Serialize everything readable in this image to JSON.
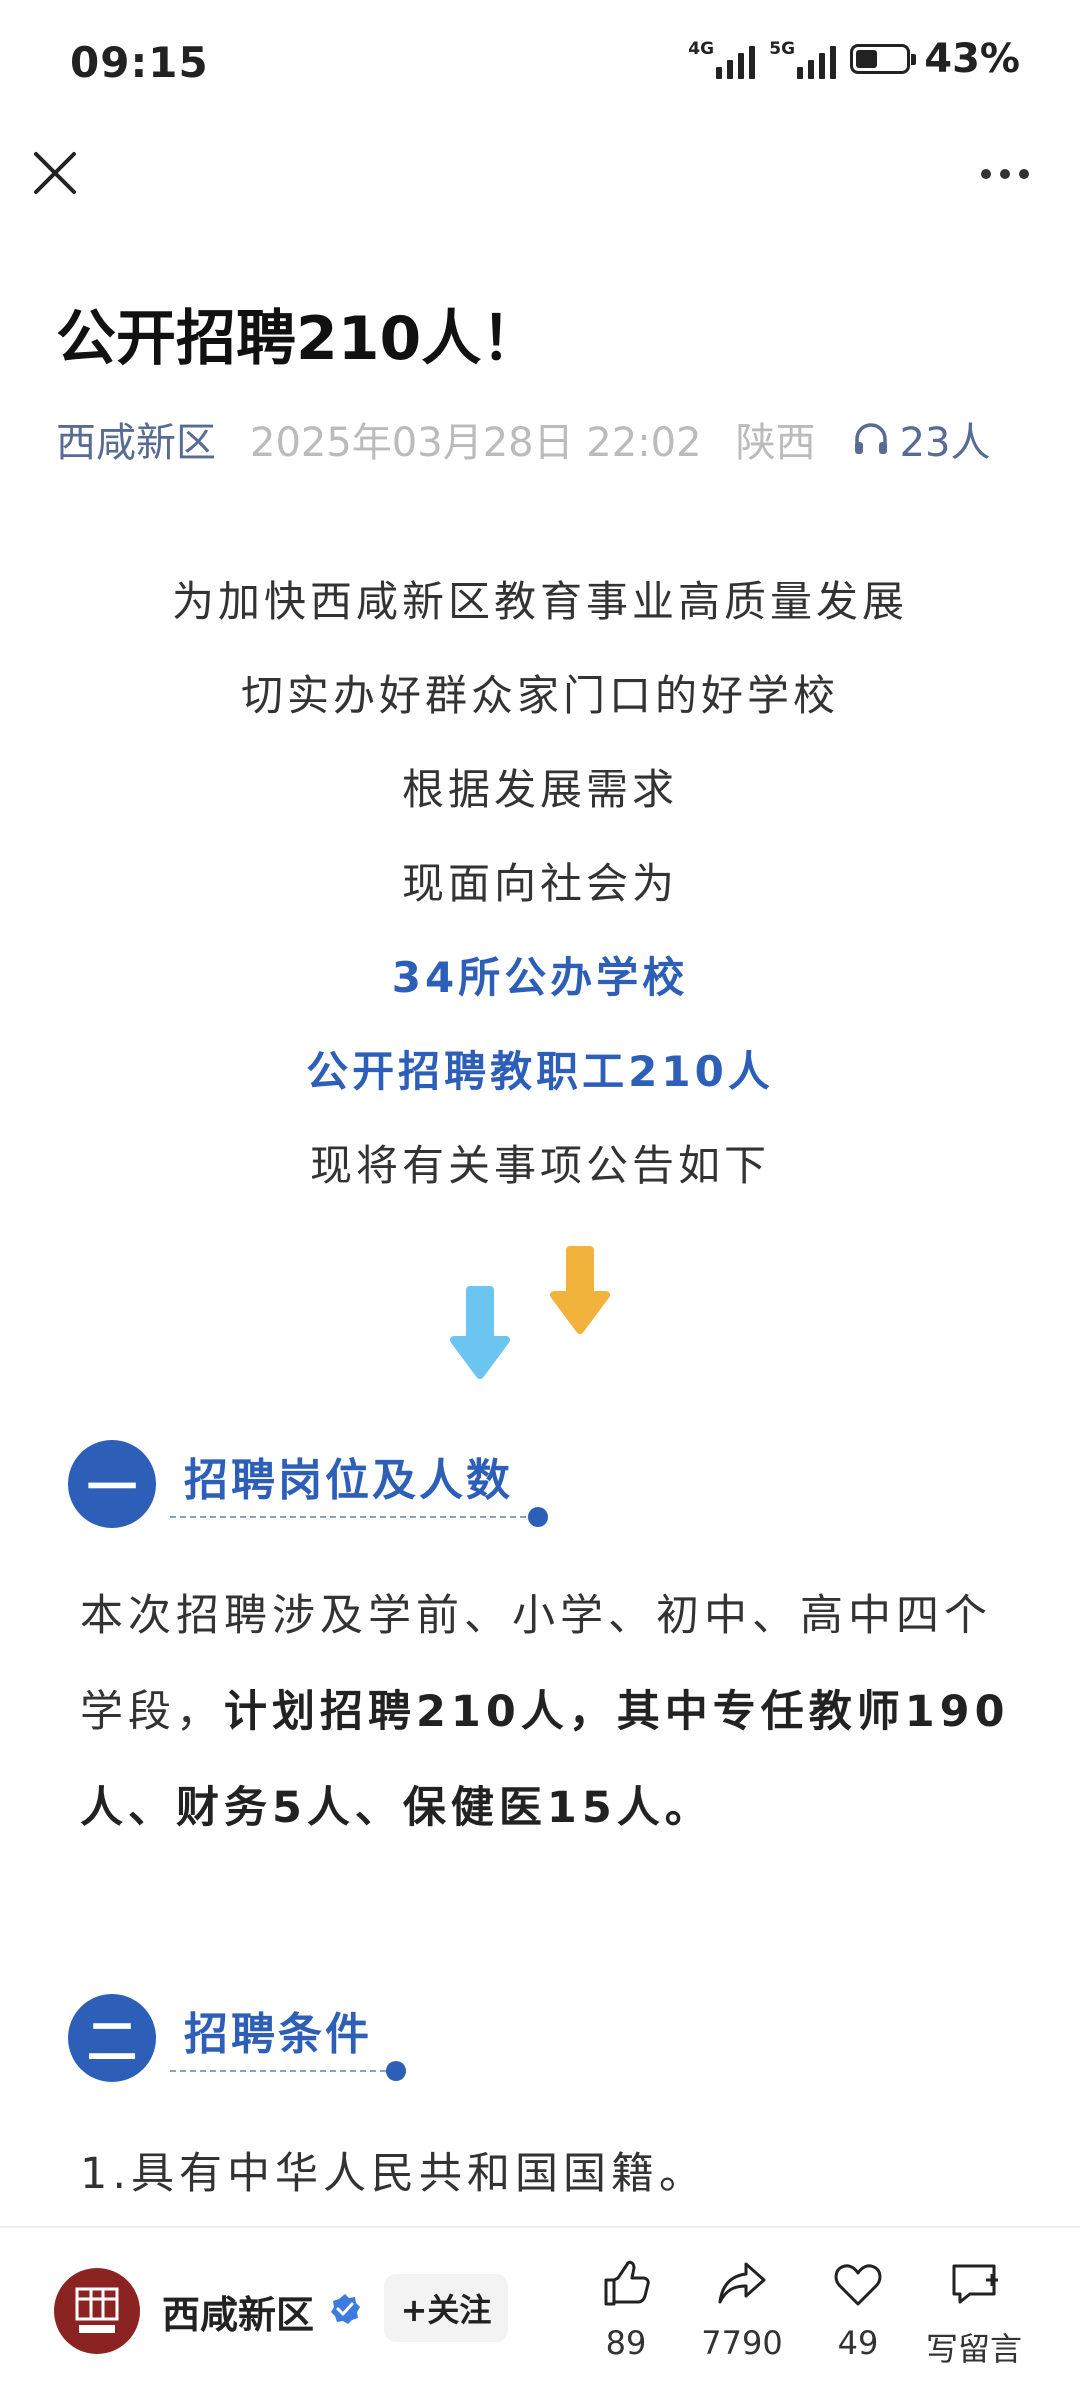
{
  "status_bar": {
    "time": "09:15",
    "signal1_label": "4G",
    "signal2_label": "5G",
    "battery_percent": "43%",
    "battery_level": 0.43
  },
  "article": {
    "title": "公开招聘210人！",
    "author": "西咸新区",
    "date": "2025年03月28日 22:02",
    "location": "陕西",
    "listeners": "23人",
    "intro_lines": [
      "为加快西咸新区教育事业高质量发展",
      "切实办好群众家门口的好学校",
      "根据发展需求",
      "现面向社会为",
      "34所公办学校",
      "公开招聘教职工210人",
      "现将有关事项公告如下"
    ],
    "section1": {
      "number": "一",
      "title": "招聘岗位及人数",
      "text_plain": "本次招聘涉及学前、小学、初中、高中四个学段，",
      "text_bold": "计划招聘210人，其中专任教师190人、财务5人、保健医15人。"
    },
    "section2": {
      "number": "二",
      "title": "招聘条件",
      "item1": "1.具有中华人民共和国国籍。"
    }
  },
  "bottom_bar": {
    "account_name": "西咸新区",
    "avatar_text": "西咸新区",
    "follow_label": "+关注",
    "likes": "89",
    "shares": "7790",
    "favorites": "49",
    "comment_label": "写留言"
  },
  "colors": {
    "accent_blue": "#2d5fb8",
    "author_link": "#576b95",
    "arrow_blue": "#6cc4f0",
    "arrow_orange": "#f2b33d"
  }
}
